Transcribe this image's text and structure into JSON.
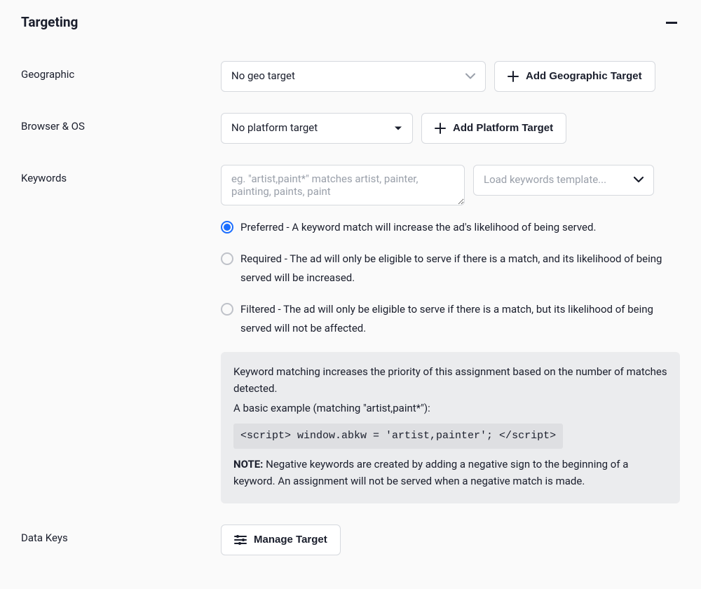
{
  "section": {
    "title": "Targeting"
  },
  "geographic": {
    "label": "Geographic",
    "select_value": "No geo target",
    "add_button": "Add Geographic Target"
  },
  "browser_os": {
    "label": "Browser & OS",
    "select_value": "No platform target",
    "add_button": "Add Platform Target"
  },
  "keywords": {
    "label": "Keywords",
    "placeholder": "eg. \"artist,paint*\" matches artist, painter, painting, paints, paint",
    "load_template_label": "Load keywords template...",
    "options": {
      "preferred": "Preferred - A keyword match will increase the ad's likelihood of being served.",
      "required": "Required - The ad will only be eligible to serve if there is a match, and its likelihood of being served will be increased.",
      "filtered": "Filtered - The ad will only be eligible to serve if there is a match, but its likelihood of being served will not be affected."
    },
    "info": {
      "line1": "Keyword matching increases the priority of this assignment based on the number of matches detected.",
      "line2": "A basic example (matching \"artist,paint*\"):",
      "code": "<script> window.abkw = 'artist,painter'; </script>",
      "note_label": "NOTE:",
      "note_text": " Negative keywords are created by adding a negative sign to the beginning of a keyword. An assignment will not be served when a negative match is made."
    }
  },
  "data_keys": {
    "label": "Data Keys",
    "manage_button": "Manage Target"
  }
}
